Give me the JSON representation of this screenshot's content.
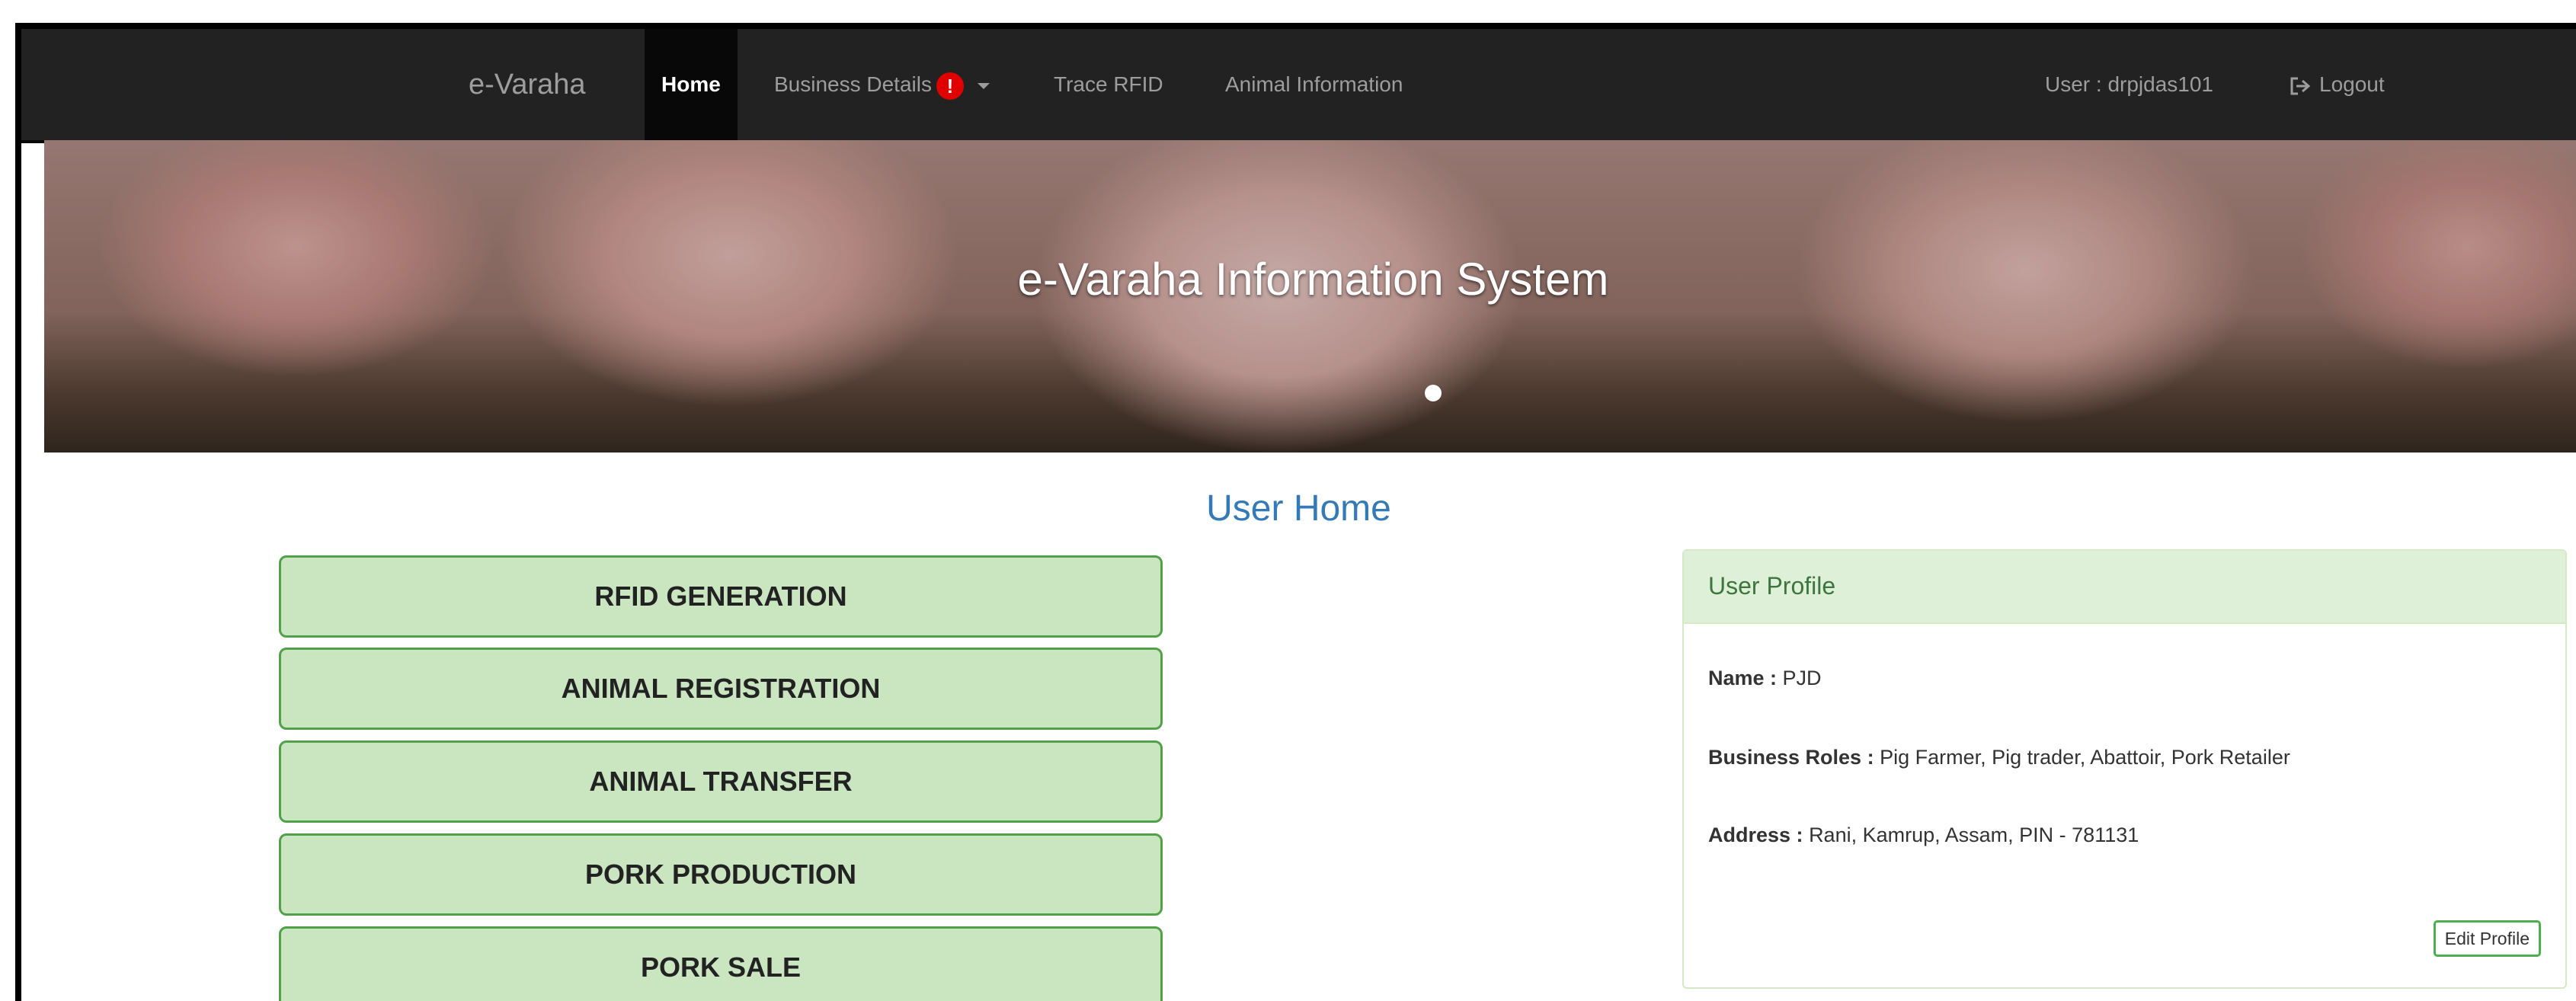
{
  "navbar": {
    "brand": "e-Varaha",
    "items": [
      {
        "label": "Home",
        "active": true
      },
      {
        "label": "Business Details",
        "badge": "!"
      },
      {
        "label": "Trace RFID"
      },
      {
        "label": "Animal Information"
      }
    ],
    "user_label": "User : drpjdas101",
    "logout_label": "Logout"
  },
  "hero": {
    "title": "e-Varaha Information System"
  },
  "main": {
    "title": "User Home",
    "actions": [
      {
        "label": "RFID GENERATION"
      },
      {
        "label": "ANIMAL REGISTRATION"
      },
      {
        "label": "ANIMAL TRANSFER"
      },
      {
        "label": "PORK PRODUCTION"
      },
      {
        "label": "PORK SALE"
      }
    ]
  },
  "profile": {
    "heading": "User Profile",
    "name_label": "Name :",
    "name_value": "PJD",
    "roles_label": "Business Roles :",
    "roles_value": "Pig Farmer, Pig trader, Abattoir, Pork Retailer",
    "address_label": "Address :",
    "address_value": "Rani, Kamrup, Assam, PIN - 781131",
    "edit_label": "Edit Profile"
  },
  "colors": {
    "navbar_bg": "#222222",
    "action_bg": "#c9e6c1",
    "action_border": "#53a04a",
    "title_blue": "#337ab7",
    "panel_heading_bg": "#dff0d8",
    "badge_red": "#e00000"
  }
}
